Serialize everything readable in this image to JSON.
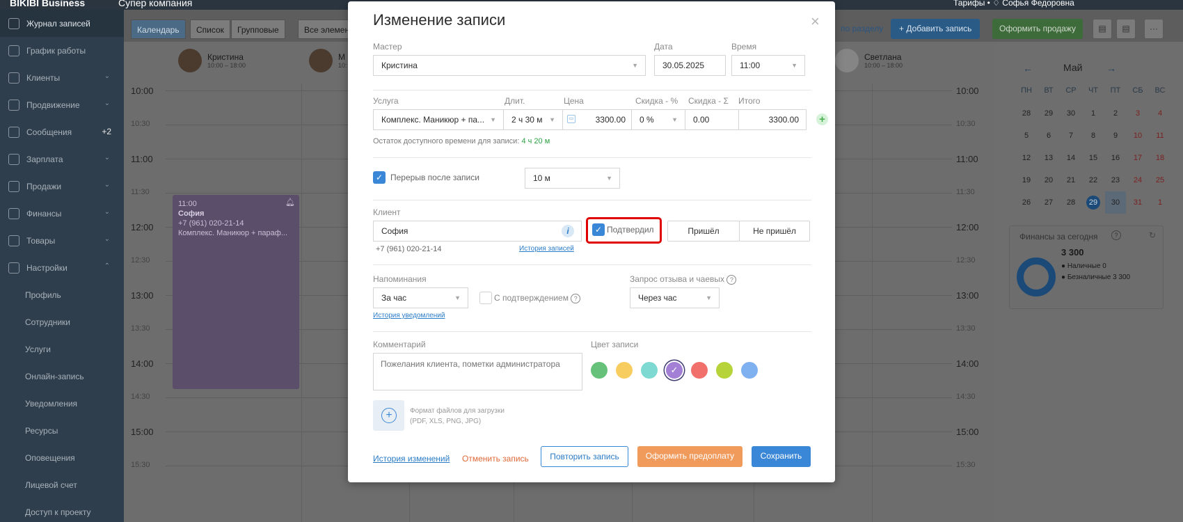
{
  "topbar": {
    "brand": "BIKIBI Business",
    "company": "Супер компания",
    "right": "Тарифы  •  ♢  Софья Федоровна"
  },
  "sidebar": {
    "items": [
      {
        "label": "Журнал записей",
        "chevron": "",
        "badge": ""
      },
      {
        "label": "График работы",
        "chevron": "",
        "badge": ""
      },
      {
        "label": "Клиенты",
        "chevron": "⌄",
        "badge": ""
      },
      {
        "label": "Продвижение",
        "chevron": "⌄",
        "badge": ""
      },
      {
        "label": "Сообщения",
        "chevron": "",
        "badge": "+2"
      },
      {
        "label": "Зарплата",
        "chevron": "⌄",
        "badge": ""
      },
      {
        "label": "Продажи",
        "chevron": "⌄",
        "badge": ""
      },
      {
        "label": "Финансы",
        "chevron": "⌄",
        "badge": ""
      },
      {
        "label": "Товары",
        "chevron": "⌄",
        "badge": ""
      },
      {
        "label": "Настройки",
        "chevron": "⌃",
        "badge": ""
      }
    ],
    "subitems": [
      "Профиль",
      "Сотрудники",
      "Услуги",
      "Онлайн-запись",
      "Уведомления",
      "Ресурсы",
      "Оповещения",
      "Лицевой счет",
      "Доступ к проекту"
    ]
  },
  "toolbar": {
    "tabs": [
      "Календарь",
      "Список",
      "Групповые"
    ],
    "filter": "Все элементы",
    "section_link": "по разделу",
    "add_record": "+ Добавить запись",
    "sale": "Оформить продажу",
    "more": "···"
  },
  "masters": [
    {
      "name": "Кристина",
      "hours": "10:00 – 18:00"
    },
    {
      "name": "М",
      "hours": "10:"
    },
    {
      "name": "Светлана",
      "hours": "10:00 – 18:00"
    }
  ],
  "times": {
    "t1000": "10:00",
    "t1030": "10:30",
    "t1100": "11:00",
    "t1130": "11:30",
    "t1200": "12:00",
    "t1230": "12:30",
    "t1300": "13:00",
    "t1330": "13:30",
    "t1400": "14:00",
    "t1430": "14:30",
    "t1500": "15:00",
    "t1530": "15:30"
  },
  "appointment": {
    "time": "11:00",
    "client": "София",
    "phone": "+7 (961) 020-21-14",
    "service": "Комплекс. Маникюр + параф..."
  },
  "calendar": {
    "month": "Май",
    "weekdays": [
      "ПН",
      "ВТ",
      "СР",
      "ЧТ",
      "ПТ",
      "СБ",
      "ВС"
    ],
    "weeks": [
      [
        "28",
        "29",
        "30",
        "1",
        "2",
        "3",
        "4"
      ],
      [
        "5",
        "6",
        "7",
        "8",
        "9",
        "10",
        "11"
      ],
      [
        "12",
        "13",
        "14",
        "15",
        "16",
        "17",
        "18"
      ],
      [
        "19",
        "20",
        "21",
        "22",
        "23",
        "24",
        "25"
      ],
      [
        "26",
        "27",
        "28",
        "29",
        "30",
        "31",
        "1"
      ]
    ]
  },
  "finance": {
    "title": "Финансы за сегодня",
    "total": "3 300",
    "cash": "Наличные 0",
    "cashless": "Безналичные 3 300"
  },
  "modal": {
    "title": "Изменение записи",
    "close": "×",
    "master_label": "Мастер",
    "master_value": "Кристина",
    "date_label": "Дата",
    "date_value": "30.05.2025",
    "time_label": "Время",
    "time_value": "11:00",
    "service_label": "Услуга",
    "service_value": "Комплекс. Маникюр + па...",
    "duration_label": "Длит.",
    "duration_value": "2 ч 30 м",
    "price_label": "Цена",
    "price_value": "3300.00",
    "discount_pct_label": "Скидка - %",
    "discount_pct_value": "0 %",
    "discount_sum_label": "Скидка - Σ",
    "discount_sum_value": "0.00",
    "total_label": "Итого",
    "total_value": "3300.00",
    "remaining_text": "Остаток доступного времени для записи:",
    "remaining_value": "4 ч 20 м",
    "break_label": "Перерыв после записи",
    "break_value": "10 м",
    "client_label": "Клиент",
    "client_value": "София",
    "client_phone": "+7 (961) 020-21-14",
    "history_link": "История записей",
    "confirmed_label": "Подтвердил",
    "came_label": "Пришёл",
    "not_came_label": "Не пришёл",
    "reminders_label": "Напоминания",
    "reminder_value": "За час",
    "with_confirmation_label": "С подтверждением",
    "notifications_history": "История уведомлений",
    "review_label": "Запрос отзыва и чаевых",
    "review_value": "Через час",
    "comment_label": "Комментарий",
    "comment_placeholder": "Пожелания клиента, пометки администратора",
    "color_label": "Цвет записи",
    "colors": [
      "#66c27a",
      "#f8cd5f",
      "#7dd9d1",
      "#a380d6",
      "#f2706c",
      "#b6d43a",
      "#7fb1f0"
    ],
    "files_line1": "Формат файлов для загрузки",
    "files_line2": "(PDF, XLS, PNG, JPG)",
    "changes_history": "История изменений",
    "cancel_record": "Отменить запись",
    "repeat_record": "Повторить запись",
    "prepay": "Оформить предоплату",
    "save": "Сохранить"
  }
}
